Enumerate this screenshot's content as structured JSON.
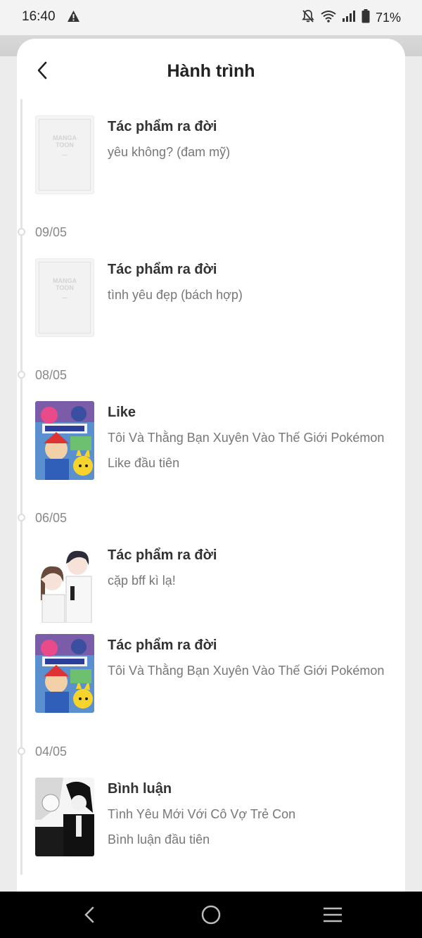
{
  "status_bar": {
    "time": "16:40",
    "battery": "71%",
    "icons": [
      "warning-icon",
      "bell-muted-icon",
      "wifi-icon",
      "signal-icon",
      "battery-icon"
    ]
  },
  "header": {
    "title": "Hành trình",
    "back_icon": "chevron-left-icon"
  },
  "placeholder_logo": [
    "MANGA",
    "TOON"
  ],
  "timeline": {
    "groups": [
      {
        "date": "",
        "items": [
          {
            "type": "Tác phẩm ra đời",
            "work": "yêu không? (đam mỹ)",
            "cover": "placeholder"
          }
        ]
      },
      {
        "date": "09/05",
        "items": [
          {
            "type": "Tác phẩm ra đời",
            "work": "tình yêu đẹp (bách hợp)",
            "cover": "placeholder"
          }
        ]
      },
      {
        "date": "08/05",
        "items": [
          {
            "type": "Like",
            "work": "Tôi Và Thằng Bạn Xuyên Vào Thế Giới Pokémon",
            "note": "Like đầu tiên",
            "cover": "pokemon-cover"
          }
        ]
      },
      {
        "date": "06/05",
        "items": [
          {
            "type": "Tác phẩm ra đời",
            "work": "cặp bff kì lạ!",
            "cover": "couple-cover"
          },
          {
            "type": "Tác phẩm ra đời",
            "work": "Tôi Và Thằng Bạn Xuyên Vào Thế Giới Pokémon",
            "cover": "pokemon-cover"
          }
        ]
      },
      {
        "date": "04/05",
        "items": [
          {
            "type": "Bình luận",
            "work": "Tình Yêu Mới Với Cô Vợ Trẻ Con",
            "note": "Bình luận đầu tiên",
            "cover": "bw-manga-cover"
          }
        ]
      }
    ]
  },
  "nav_bar": {
    "buttons": [
      "back-icon",
      "home-icon",
      "menu-icon"
    ]
  }
}
